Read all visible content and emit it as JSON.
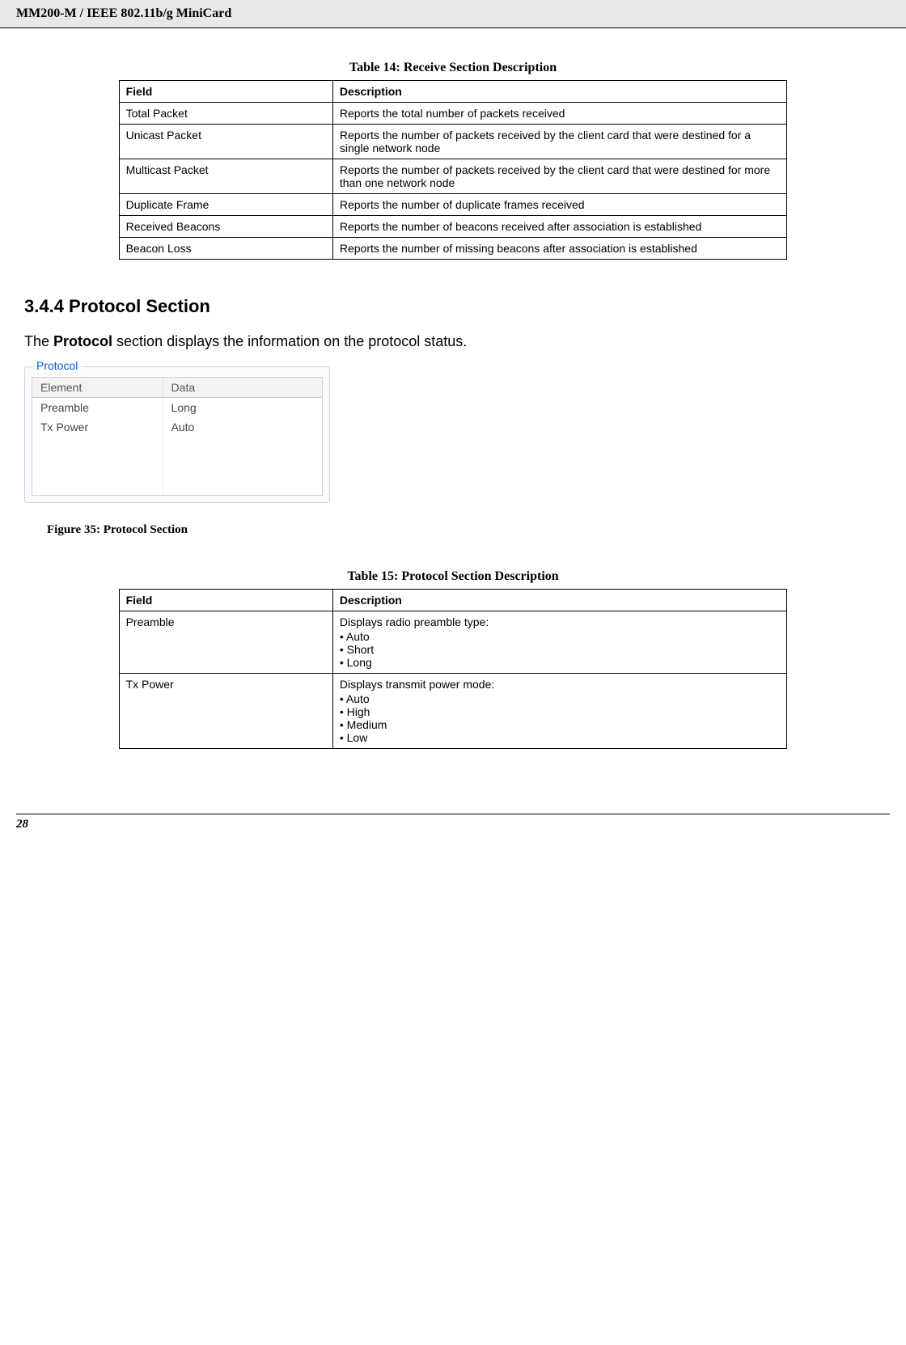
{
  "header": {
    "title": "MM200-M / IEEE 802.11b/g MiniCard"
  },
  "table14": {
    "caption": "Table 14: Receive Section Description",
    "headers": {
      "field": "Field",
      "description": "Description"
    },
    "rows": [
      {
        "field": "Total Packet",
        "description": "Reports the total number of packets received"
      },
      {
        "field": "Unicast Packet",
        "description": "Reports the number of packets received by the client card that were destined for\na single network node"
      },
      {
        "field": "Multicast Packet",
        "description": "Reports the number of packets received by the client card that were destined for\nmore than one network node"
      },
      {
        "field": "Duplicate Frame",
        "description": "Reports the number of duplicate frames received"
      },
      {
        "field": "Received Beacons",
        "description": "Reports the number of beacons received after association is established"
      },
      {
        "field": "Beacon Loss",
        "description": "Reports the number of missing beacons after association is established"
      }
    ]
  },
  "section": {
    "heading": "3.4.4 Protocol Section",
    "body_prefix": "The ",
    "body_bold": "Protocol",
    "body_suffix": " section displays the information on the protocol status."
  },
  "protocol_panel": {
    "legend": "Protocol",
    "headers": {
      "element": "Element",
      "data": "Data"
    },
    "rows": [
      {
        "element": "Preamble",
        "data": "Long"
      },
      {
        "element": "Tx Power",
        "data": "Auto"
      }
    ]
  },
  "figure35": {
    "caption": "Figure 35: Protocol Section"
  },
  "table15": {
    "caption": "Table 15: Protocol Section Description",
    "headers": {
      "field": "Field",
      "description": "Description"
    },
    "rows": [
      {
        "field": "Preamble",
        "lead": "Displays radio preamble type:",
        "bullets": [
          "Auto",
          "Short",
          "Long"
        ]
      },
      {
        "field": "Tx Power",
        "lead": "Displays transmit power mode:",
        "bullets": [
          "Auto",
          "High",
          "Medium",
          "Low"
        ]
      }
    ]
  },
  "footer": {
    "page": "28"
  }
}
